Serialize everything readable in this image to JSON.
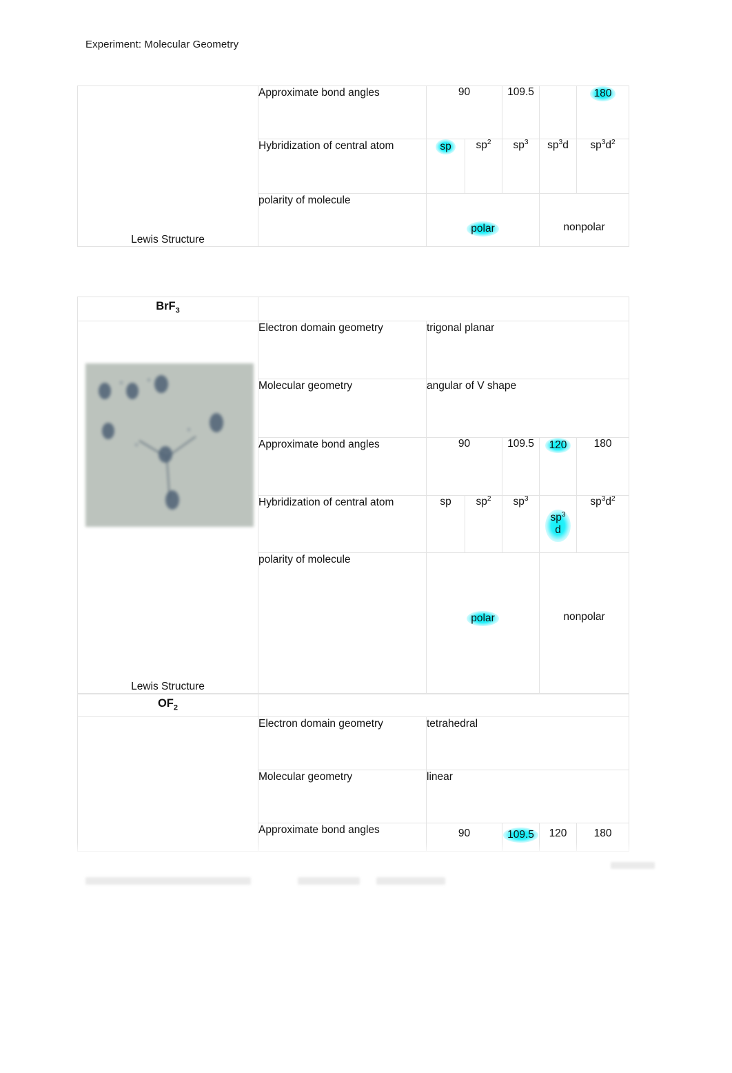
{
  "document": {
    "header": "Experiment: Molecular Geometry",
    "lewis_caption": "Lewis Structure"
  },
  "labels": {
    "electron_domain_geometry": "Electron domain geometry",
    "molecular_geometry": "Molecular geometry",
    "bond_angles": "Approximate bond angles",
    "hybridization": "Hybridization of central atom",
    "polarity": "polarity of molecule"
  },
  "options": {
    "angles": [
      "90",
      "109.5",
      "120",
      "180"
    ],
    "hybridization": [
      "sp",
      "sp3",
      "sp3",
      "sp3d",
      "sp3d2"
    ],
    "polarity": [
      "polar",
      "nonpolar"
    ]
  },
  "sections": [
    {
      "id": "section-top-partial",
      "formula": "",
      "lewis_caption": "Lewis Structure",
      "rows": {
        "bond_angles": {
          "label": "Approximate bond angles",
          "options": [
            "90",
            "109.5",
            "",
            "180"
          ],
          "selected": "180"
        },
        "hybridization": {
          "label": "Hybridization of central atom",
          "options": [
            "sp",
            "sp2",
            "sp3",
            "sp3d",
            "sp3d2"
          ],
          "selected": "sp"
        },
        "polarity": {
          "label": "polarity of molecule",
          "options": [
            "polar",
            "nonpolar"
          ],
          "selected": "polar"
        }
      }
    },
    {
      "id": "section-brf3",
      "formula_base": "BrF",
      "formula_sub": "3",
      "lewis_caption": "Lewis Structure",
      "rows": {
        "electron_domain_geometry": {
          "label": "Electron domain geometry",
          "value": "trigonal planar"
        },
        "molecular_geometry": {
          "label": "Molecular geometry",
          "value": "angular of V shape"
        },
        "bond_angles": {
          "label": "Approximate bond angles",
          "options": [
            "90",
            "109.5",
            "120",
            "180"
          ],
          "selected": "120"
        },
        "hybridization": {
          "label": "Hybridization of central atom",
          "options": [
            "sp",
            "sp2",
            "sp3",
            "sp3d",
            "sp3d2"
          ],
          "selected": "sp3d"
        },
        "polarity": {
          "label": "polarity of molecule",
          "options": [
            "polar",
            "nonpolar"
          ],
          "selected": "polar"
        }
      }
    },
    {
      "id": "section-of2",
      "formula_base": "OF",
      "formula_sub": "2",
      "rows": {
        "electron_domain_geometry": {
          "label": "Electron domain geometry",
          "value": "tetrahedral"
        },
        "molecular_geometry": {
          "label": "Molecular geometry",
          "value": "linear"
        },
        "bond_angles": {
          "label": "Approximate bond angles",
          "options": [
            "90",
            "109.5",
            "120",
            "180"
          ],
          "selected": "109.5"
        }
      }
    }
  ],
  "colors": {
    "highlight": "#00EEF4",
    "border": "#E3E3E3",
    "text": "#111111",
    "scan_background": "#B9C0BB"
  }
}
